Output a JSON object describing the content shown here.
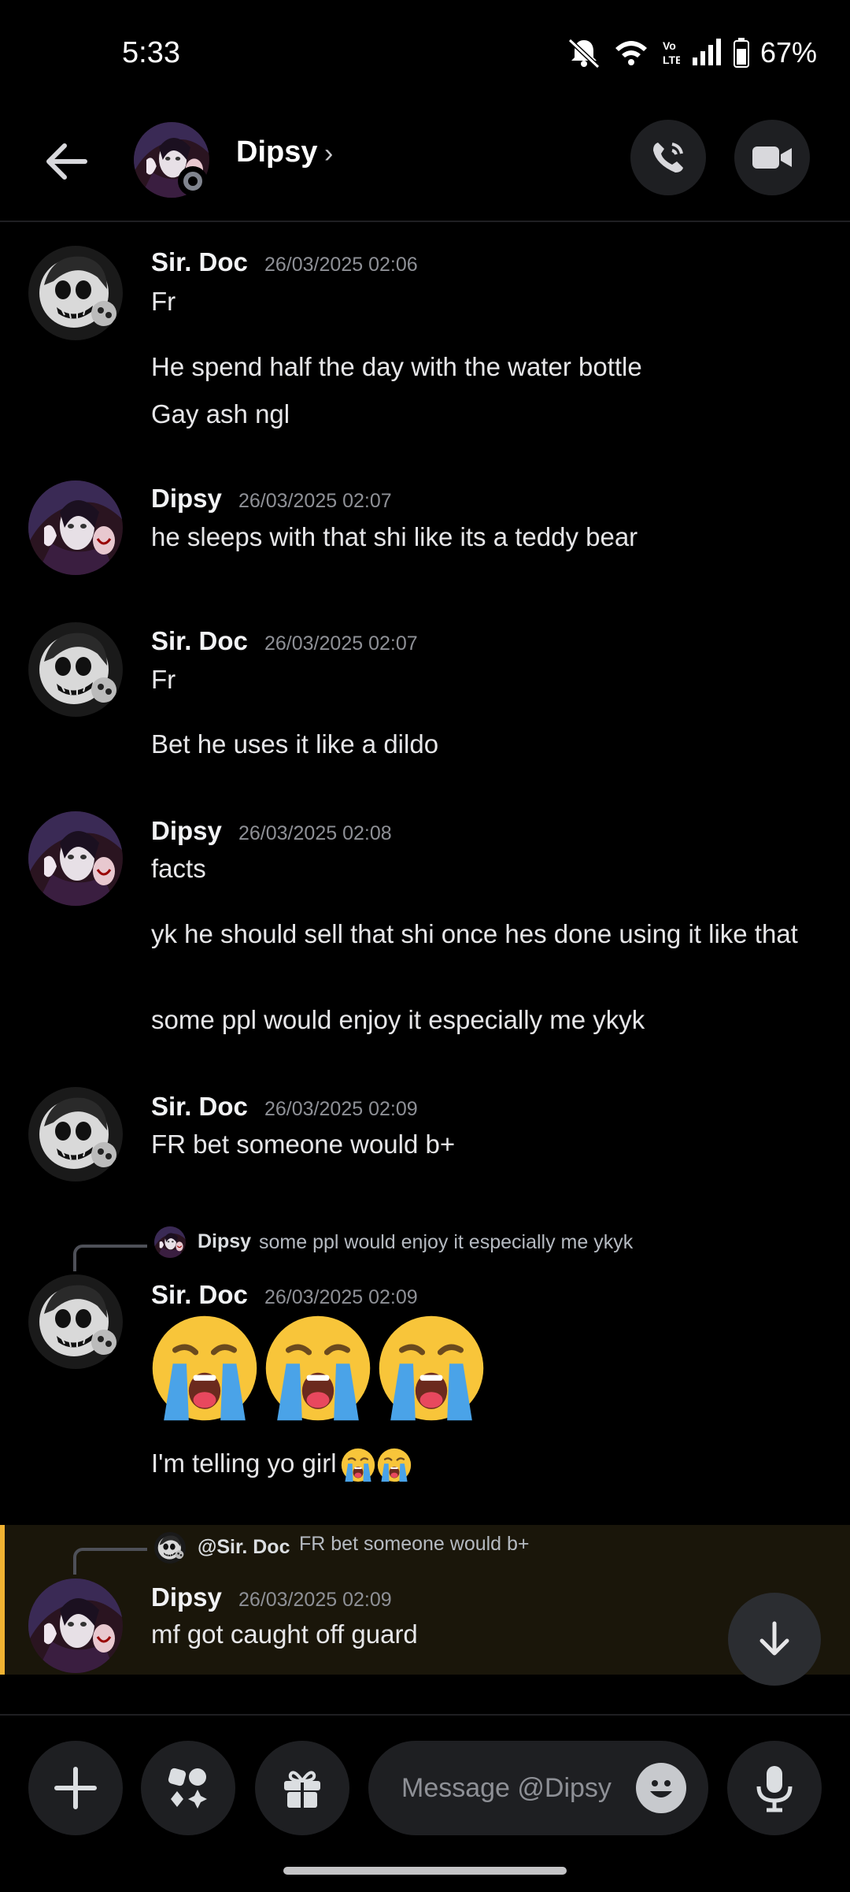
{
  "status_bar": {
    "time": "5:33",
    "battery": "67%"
  },
  "header": {
    "name": "Dipsy",
    "chevron": "›"
  },
  "messages": [
    {
      "author": "Sir. Doc",
      "time": "26/03/2025 02:06",
      "lines": [
        "Fr",
        "He spend half the day with the water bottle",
        "Gay ash ngl"
      ]
    },
    {
      "author": "Dipsy",
      "time": "26/03/2025 02:07",
      "lines": [
        "he sleeps with that shi like its a teddy bear"
      ]
    },
    {
      "author": "Sir. Doc",
      "time": "26/03/2025 02:07",
      "lines": [
        "Fr",
        "Bet he uses it like a dildo"
      ]
    },
    {
      "author": "Dipsy",
      "time": "26/03/2025 02:08",
      "lines": [
        "facts",
        "yk he should sell that shi once hes done using it like that",
        "some ppl would enjoy it especially me ykyk"
      ]
    },
    {
      "author": "Sir. Doc",
      "time": "26/03/2025 02:09",
      "lines": [
        "FR bet someone would b+"
      ]
    },
    {
      "author": "Sir. Doc",
      "time": "26/03/2025 02:09",
      "reply_name": "Dipsy",
      "reply_text": "some ppl would enjoy it especially me ykyk",
      "emoji": "loudly-crying-face x3",
      "lines": [
        "I'm telling yo girl"
      ]
    },
    {
      "author": "Dipsy",
      "time": "26/03/2025 02:09",
      "reply_name": "@Sir. Doc",
      "reply_text": "FR bet someone would b+",
      "lines": [
        "mf got caught off guard"
      ]
    }
  ],
  "input": {
    "placeholder": "Message @Dipsy"
  },
  "colors": {
    "mention_highlight": "#f0b232",
    "bg": "#000000",
    "button_bg": "#1e1f22"
  }
}
